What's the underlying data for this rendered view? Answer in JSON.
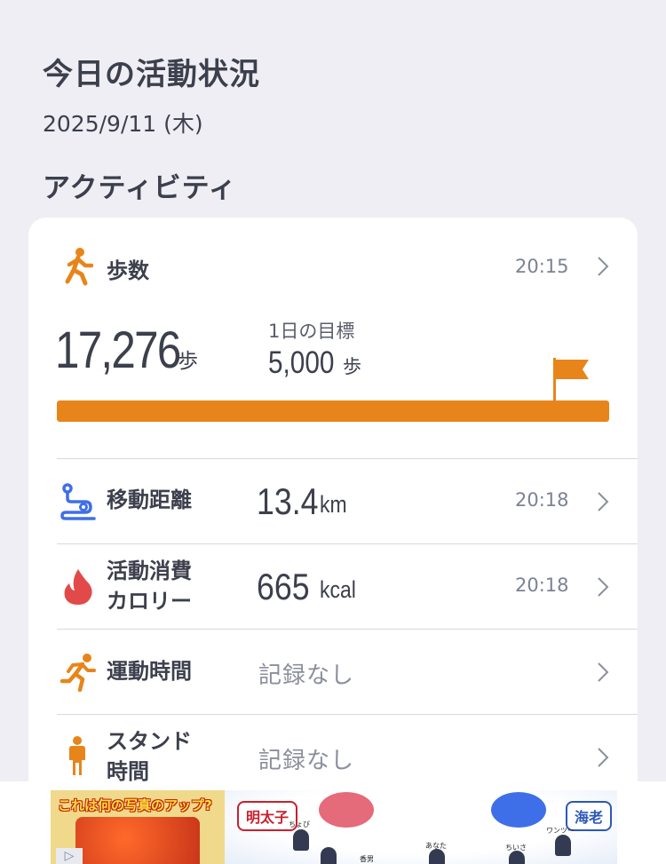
{
  "header": {
    "title": "今日の活動状況",
    "date": "2025/9/11 (木)"
  },
  "activity": {
    "section_title": "アクティビティ",
    "steps": {
      "label": "歩数",
      "time": "20:15",
      "value": "17,276",
      "unit": "歩",
      "goal_label": "1日の目標",
      "goal_value": "5,000",
      "goal_unit": "歩",
      "progress_fraction": 1.0,
      "icon": "walking-person-icon"
    },
    "distance": {
      "label": "移動距離",
      "value": "13.4",
      "unit": "km",
      "time": "20:18",
      "icon": "route-icon"
    },
    "calories": {
      "label_line1": "活動消費",
      "label_line2": "カロリー",
      "value": "665",
      "unit": "kcal",
      "time": "20:18",
      "icon": "flame-icon"
    },
    "exercise": {
      "label": "運動時間",
      "value": "記録なし",
      "icon": "running-person-icon"
    },
    "stand": {
      "label_line1": "スタンド",
      "label_line2": "時間",
      "value": "記録なし",
      "icon": "standing-person-icon"
    }
  },
  "ad": {
    "headline": "これは何の写真のアップ?",
    "option_left": "明太子",
    "option_right": "海老",
    "names": [
      "ちょび",
      "香男",
      "あなた",
      "ちいさ",
      "ワンツー"
    ]
  },
  "colors": {
    "accent_orange": "#e8851a",
    "route_blue": "#3f6fe8",
    "flame_red": "#e24a4a",
    "background": "#eeeef4"
  }
}
